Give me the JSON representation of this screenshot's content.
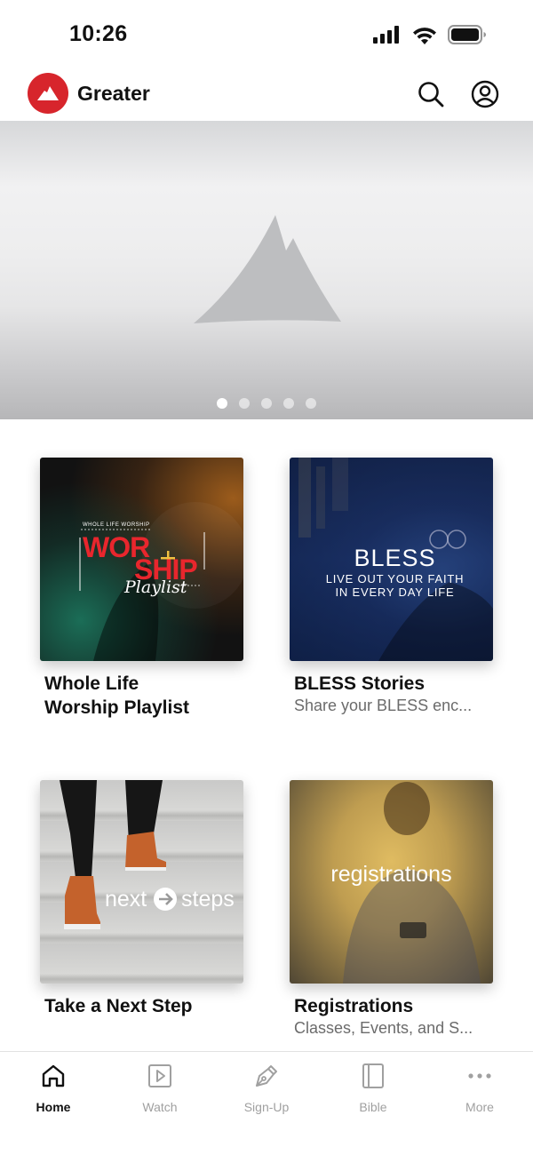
{
  "status_bar": {
    "time": "10:26"
  },
  "header": {
    "title": "Greater",
    "brand_color": "#d7252c"
  },
  "hero": {
    "total_slides": 5,
    "active_slide": 1
  },
  "cards": [
    {
      "title_line1": "Whole Life",
      "title_line2": "Worship Playlist",
      "subtitle": "",
      "image": {
        "kicker": "WHOLE LIFE WORSHIP",
        "headline_a": "WOR",
        "headline_b": "SHIP",
        "script": "Playlist",
        "headline_color": "#e8262d"
      }
    },
    {
      "title_line1": "BLESS Stories",
      "title_line2": "",
      "subtitle": "Share your BLESS enc...",
      "image": {
        "headline": "BLESS",
        "line1": "LIVE OUT YOUR FAITH",
        "line2": "IN EVERY DAY LIFE"
      }
    },
    {
      "title_line1": "Take a Next Step",
      "title_line2": "",
      "subtitle": "",
      "image": {
        "word1": "next",
        "word2": "steps"
      }
    },
    {
      "title_line1": "Registrations",
      "title_line2": "",
      "subtitle": "Classes, Events, and S...",
      "image": {
        "word": "registrations"
      }
    }
  ],
  "tabs": [
    {
      "label": "Home",
      "icon": "home-icon",
      "active": true
    },
    {
      "label": "Watch",
      "icon": "play-square-icon",
      "active": false
    },
    {
      "label": "Sign-Up",
      "icon": "pen-icon",
      "active": false
    },
    {
      "label": "Bible",
      "icon": "book-icon",
      "active": false
    },
    {
      "label": "More",
      "icon": "more-dots-icon",
      "active": false
    }
  ]
}
